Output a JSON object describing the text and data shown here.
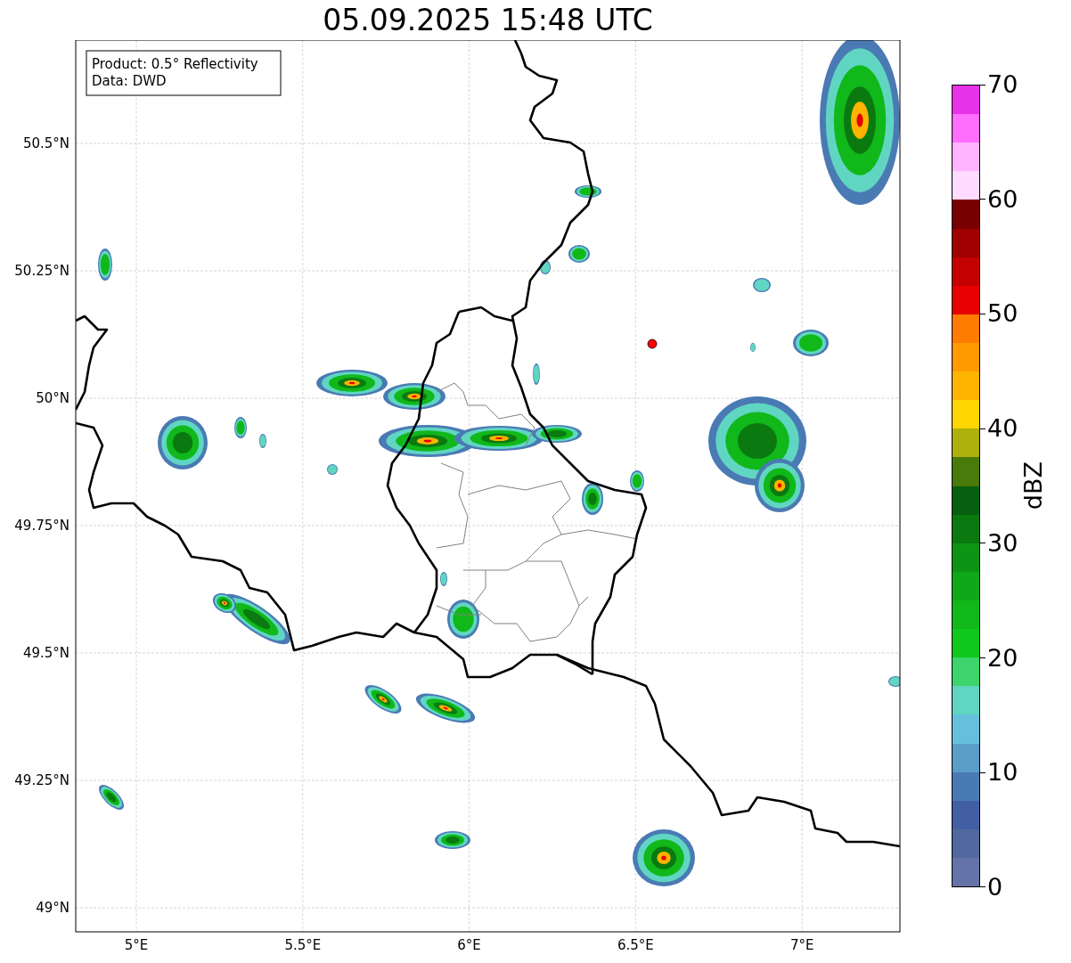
{
  "title": "05.09.2025 15:48 UTC",
  "map": {
    "info_box": [
      "Product: 0.5° Reflectivity",
      "Data: DWD"
    ],
    "x_ticks": [
      "5°E",
      "5.5°E",
      "6°E",
      "6.5°E",
      "7°E"
    ],
    "y_ticks": [
      "50.5°N",
      "50.25°N",
      "50°N",
      "49.75°N",
      "49.5°N",
      "49.25°N",
      "49°N"
    ]
  },
  "colorbar": {
    "label": "dBZ",
    "ticks": [
      "70",
      "60",
      "50",
      "40",
      "30",
      "20",
      "10",
      "0"
    ],
    "bins": [
      {
        "color": "#e832ea"
      },
      {
        "color": "#ff6eff"
      },
      {
        "color": "#ffb4ff"
      },
      {
        "color": "#ffdcff"
      },
      {
        "color": "#780000"
      },
      {
        "color": "#a00000"
      },
      {
        "color": "#c40000"
      },
      {
        "color": "#e60000"
      },
      {
        "color": "#ff7c00"
      },
      {
        "color": "#ff9a00"
      },
      {
        "color": "#ffb400"
      },
      {
        "color": "#ffd600"
      },
      {
        "color": "#b0b00a"
      },
      {
        "color": "#4a7a0a"
      },
      {
        "color": "#066010"
      },
      {
        "color": "#0a7a10"
      },
      {
        "color": "#0e9414"
      },
      {
        "color": "#10a818"
      },
      {
        "color": "#10b81a"
      },
      {
        "color": "#10c81c"
      },
      {
        "color": "#3dd46c"
      },
      {
        "color": "#60d6c2"
      },
      {
        "color": "#66c0dc"
      },
      {
        "color": "#5a9ec8"
      },
      {
        "color": "#4a7ab4"
      },
      {
        "color": "#435fa3"
      },
      {
        "color": "#52689e"
      },
      {
        "color": "#6474a8"
      }
    ]
  }
}
